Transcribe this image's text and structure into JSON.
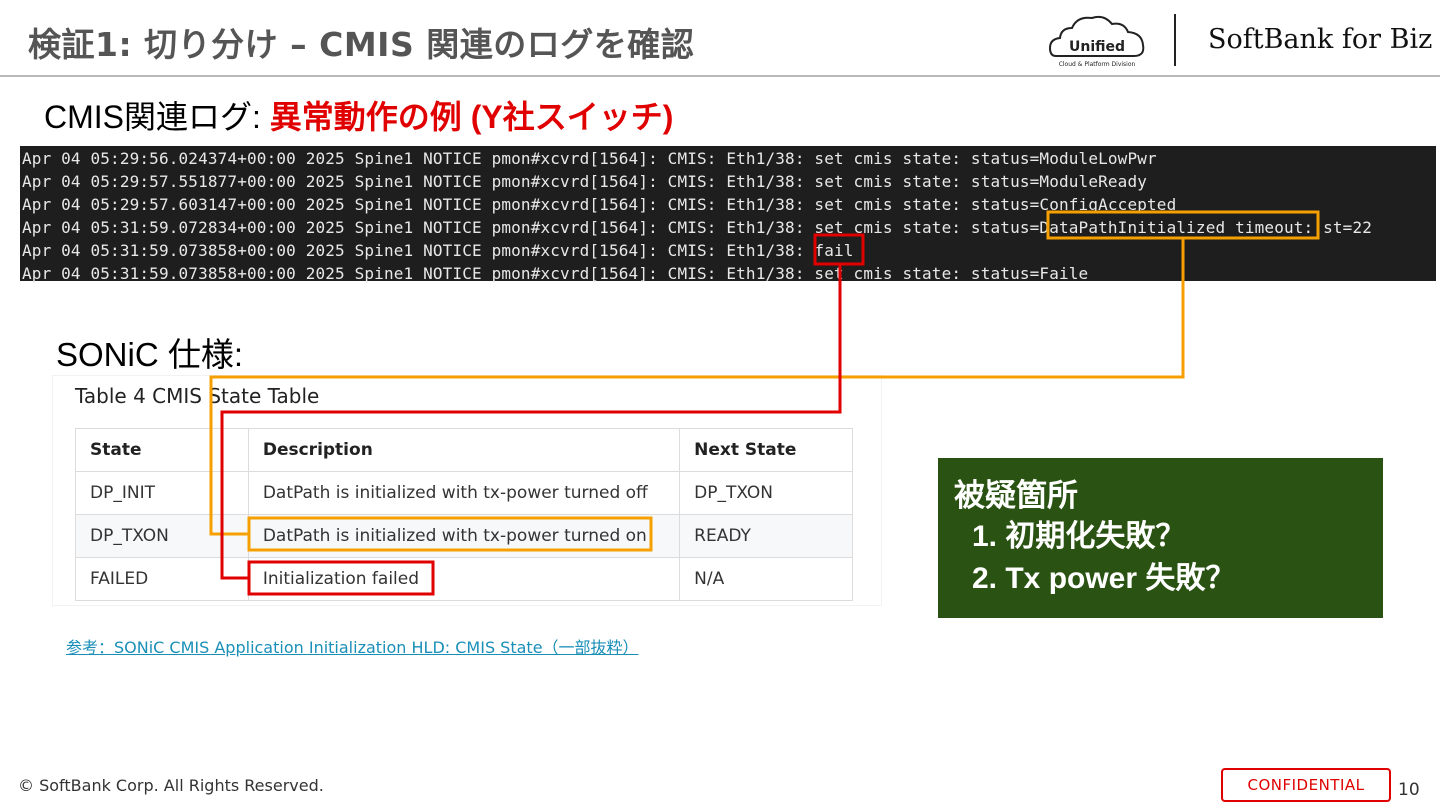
{
  "header": {
    "title": "検証1: 切り分け – CMIS 関連のログを確認",
    "logo_unified_text": "Unified",
    "logo_unified_subtext": "Cloud & Platform Division",
    "logo_softbank_text": "SoftBank for Biz"
  },
  "subtitle": {
    "prefix": "CMIS関連ログ: ",
    "highlight": "異常動作の例 (Y社スイッチ)"
  },
  "log": {
    "lines": [
      "Apr 04 05:29:56.024374+00:00 2025 Spine1 NOTICE pmon#xcvrd[1564]: CMIS: Eth1/38: set cmis state: status=ModuleLowPwr",
      "Apr 04 05:29:57.551877+00:00 2025 Spine1 NOTICE pmon#xcvrd[1564]: CMIS: Eth1/38: set cmis state: status=ModuleReady",
      "Apr 04 05:29:57.603147+00:00 2025 Spine1 NOTICE pmon#xcvrd[1564]: CMIS: Eth1/38: set cmis state: status=ConfigAccepted",
      "Apr 04 05:31:59.072834+00:00 2025 Spine1 NOTICE pmon#xcvrd[1564]: CMIS: Eth1/38: set cmis state: status=DataPathInitialized timeout: st=22",
      "Apr 04 05:31:59.073858+00:00 2025 Spine1 NOTICE pmon#xcvrd[1564]: CMIS: Eth1/38: fail",
      "Apr 04 05:31:59.073858+00:00 2025 Spine1 NOTICE pmon#xcvrd[1564]: CMIS: Eth1/38: set cmis state: status=Faile"
    ]
  },
  "spec": {
    "heading": "SONiC 仕様:",
    "table_title": "Table 4 CMIS State Table",
    "headers": [
      "State",
      "Description",
      "Next State"
    ],
    "rows": [
      [
        "DP_INIT",
        "DatPath is initialized with tx-power turned off",
        "DP_TXON"
      ],
      [
        "DP_TXON",
        "DatPath is initialized with tx-power turned on",
        "READY"
      ],
      [
        "FAILED",
        "Initialization failed",
        "N/A"
      ]
    ]
  },
  "suspect": {
    "title": "被疑箇所",
    "items": [
      "1.  初期化失敗？",
      "2.  Tx power 失敗？"
    ]
  },
  "reference": {
    "text": "参考：SONiC CMIS Application Initialization HLD: CMIS State（一部抜粋）"
  },
  "footer": {
    "copyright": "© SoftBank Corp. All Rights Reserved.",
    "confidential": "CONFIDENTIAL",
    "page_number": "10"
  },
  "colors": {
    "highlight_red": "#e00000",
    "highlight_orange": "#f5a000",
    "suspect_bg": "#2a5212",
    "log_bg": "#1e1e1e"
  }
}
